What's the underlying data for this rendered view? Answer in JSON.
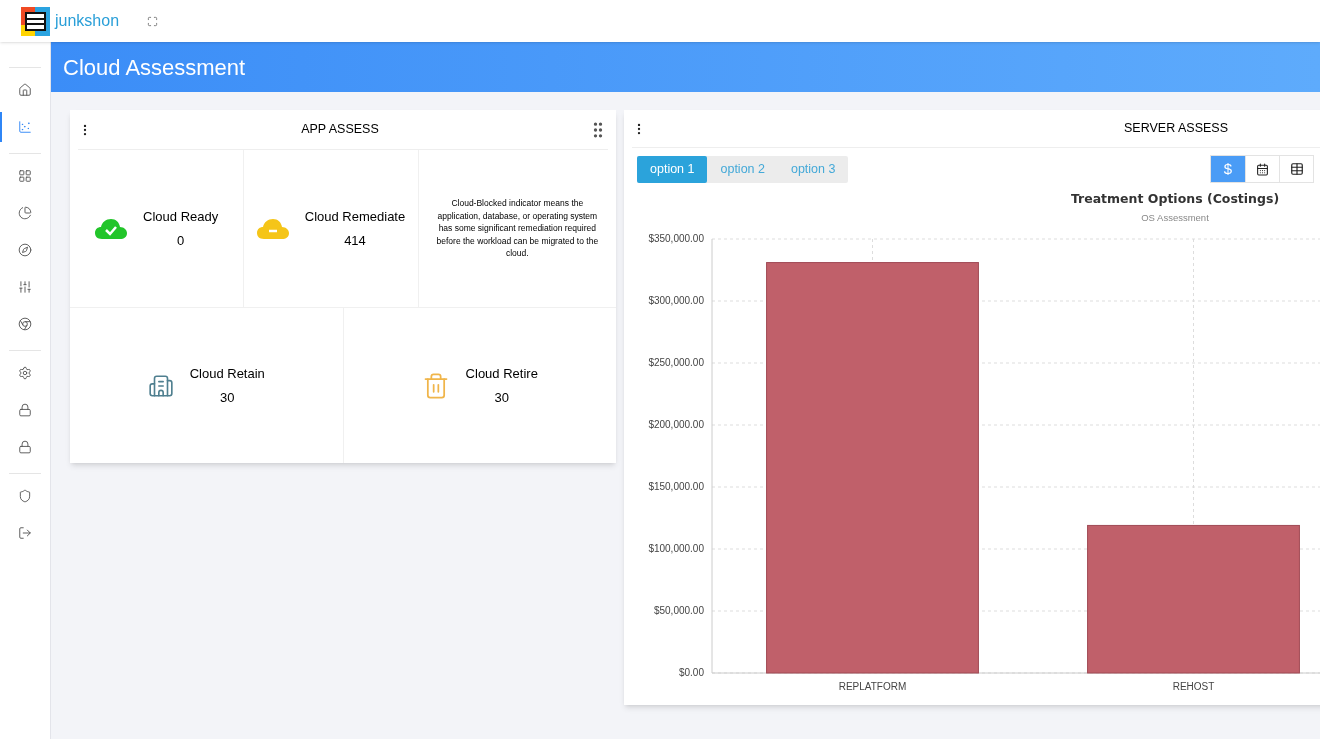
{
  "topbar": {
    "brand": "junkshon"
  },
  "sidebar": {
    "groups": [
      {
        "items": [
          {
            "selected": false
          },
          {
            "selected": true
          }
        ]
      },
      {
        "items": [
          {
            "selected": false
          },
          {
            "selected": false
          },
          {
            "selected": false
          },
          {
            "selected": false
          },
          {
            "selected": false
          }
        ]
      },
      {
        "items": [
          {
            "selected": false
          },
          {
            "selected": false
          },
          {
            "selected": false
          }
        ]
      },
      {
        "items": [
          {
            "selected": false
          },
          {
            "selected": false
          }
        ]
      }
    ]
  },
  "page_title": "Cloud Assessment",
  "app_assess": {
    "title": "APP ASSESS",
    "upper_tiles": [
      {
        "kind": "ready",
        "label": "Cloud Ready",
        "value": "0"
      },
      {
        "kind": "remediate",
        "label": "Cloud Remediate",
        "value": "414"
      },
      {
        "kind": "note",
        "text": "Cloud-Blocked indicator means the application, database, or operating system has some significant remediation required before the workload can be migrated to the cloud."
      }
    ],
    "lower_tiles": [
      {
        "kind": "retain",
        "label": "Cloud Retain",
        "value": "30"
      },
      {
        "kind": "retire",
        "label": "Cloud Retire",
        "value": "30"
      }
    ]
  },
  "server_assess": {
    "title": "SERVER ASSESS",
    "options": [
      {
        "label": "option 1",
        "selected": true
      },
      {
        "label": "option 2",
        "selected": false
      },
      {
        "label": "option 3",
        "selected": false
      }
    ],
    "views": [
      {
        "kind": "dollar",
        "label": "$",
        "selected": true
      },
      {
        "kind": "calendar",
        "selected": false
      },
      {
        "kind": "table",
        "selected": false
      }
    ],
    "chart_subtitle": "OS Assessment",
    "chart_data": {
      "type": "bar",
      "title": "Treatment Options (Costings)",
      "categories": [
        "REPLATFORM",
        "REHOST"
      ],
      "grid": true,
      "series": [
        {
          "color": "#c0606a",
          "values": [
            331000,
            119000
          ]
        }
      ],
      "ylim": [
        0,
        350000
      ],
      "yticks": [
        {
          "value": 0,
          "label": "$0.00"
        },
        {
          "value": 50000,
          "label": "$50,000.00"
        },
        {
          "value": 100000,
          "label": "$100,000.00"
        },
        {
          "value": 150000,
          "label": "$150,000.00"
        },
        {
          "value": 200000,
          "label": "$200,000.00"
        },
        {
          "value": 250000,
          "label": "$250,000.00"
        },
        {
          "value": 300000,
          "label": "$300,000.00"
        },
        {
          "value": 350000,
          "label": "$350,000.00"
        }
      ]
    }
  }
}
